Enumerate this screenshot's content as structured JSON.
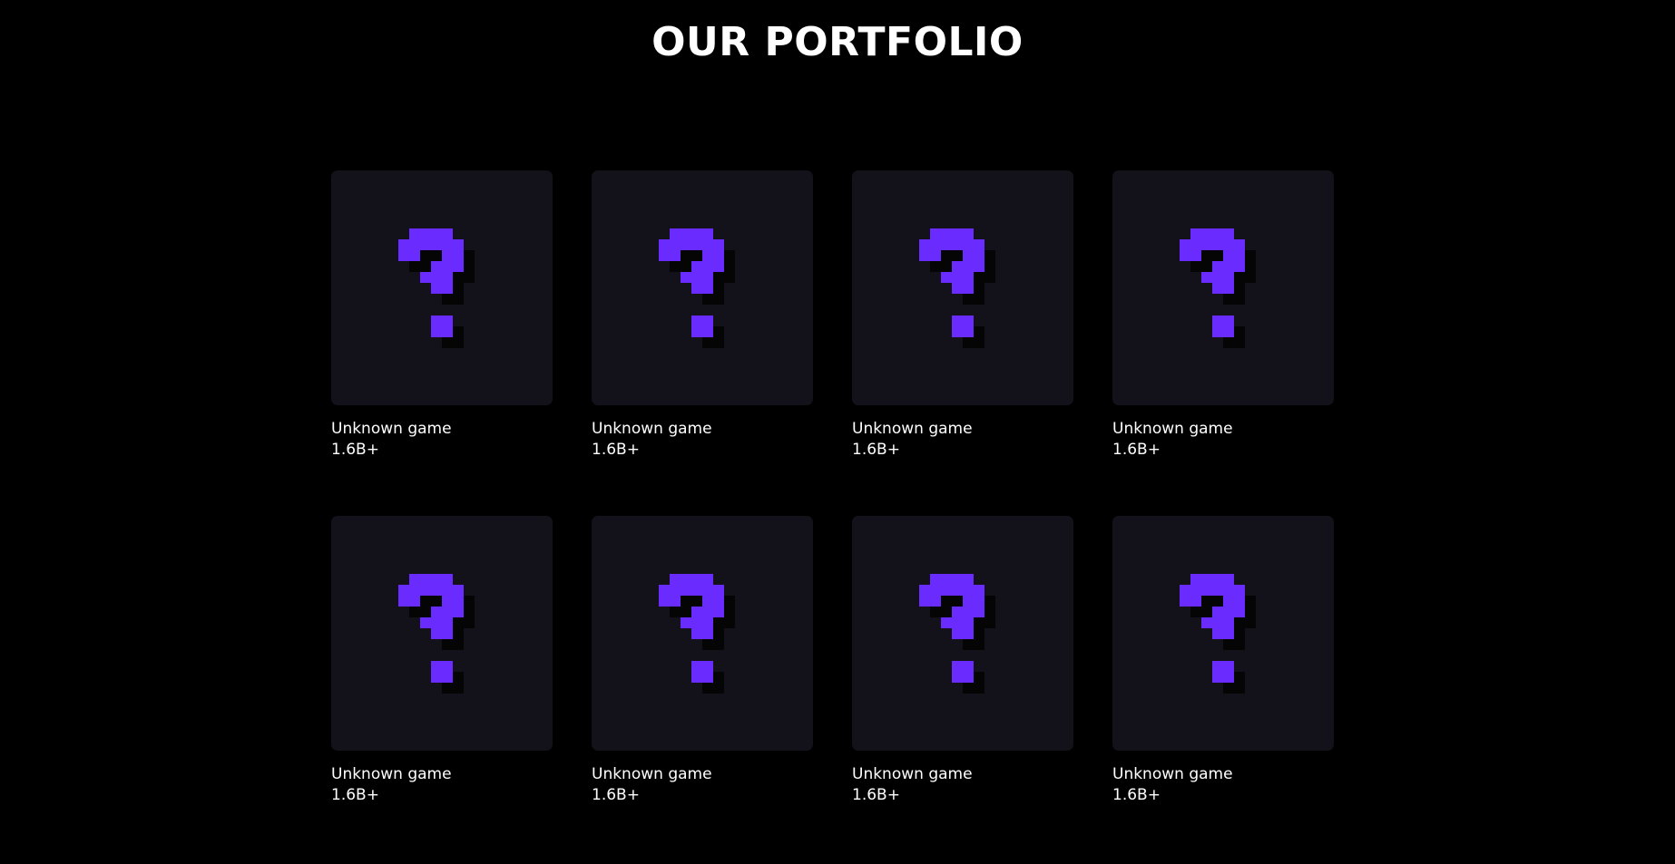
{
  "page": {
    "title": "OUR PORTFOLIO"
  },
  "colors": {
    "background": "#000000",
    "card_background": "#13121a",
    "accent": "#6a2bff",
    "text": "#ffffff"
  },
  "portfolio": {
    "items": [
      {
        "name": "Unknown game",
        "count": "1.6B+",
        "icon": "question-mark-icon"
      },
      {
        "name": "Unknown game",
        "count": "1.6B+",
        "icon": "question-mark-icon"
      },
      {
        "name": "Unknown game",
        "count": "1.6B+",
        "icon": "question-mark-icon"
      },
      {
        "name": "Unknown game",
        "count": "1.6B+",
        "icon": "question-mark-icon"
      },
      {
        "name": "Unknown game",
        "count": "1.6B+",
        "icon": "question-mark-icon"
      },
      {
        "name": "Unknown game",
        "count": "1.6B+",
        "icon": "question-mark-icon"
      },
      {
        "name": "Unknown game",
        "count": "1.6B+",
        "icon": "question-mark-icon"
      },
      {
        "name": "Unknown game",
        "count": "1.6B+",
        "icon": "question-mark-icon"
      }
    ]
  }
}
